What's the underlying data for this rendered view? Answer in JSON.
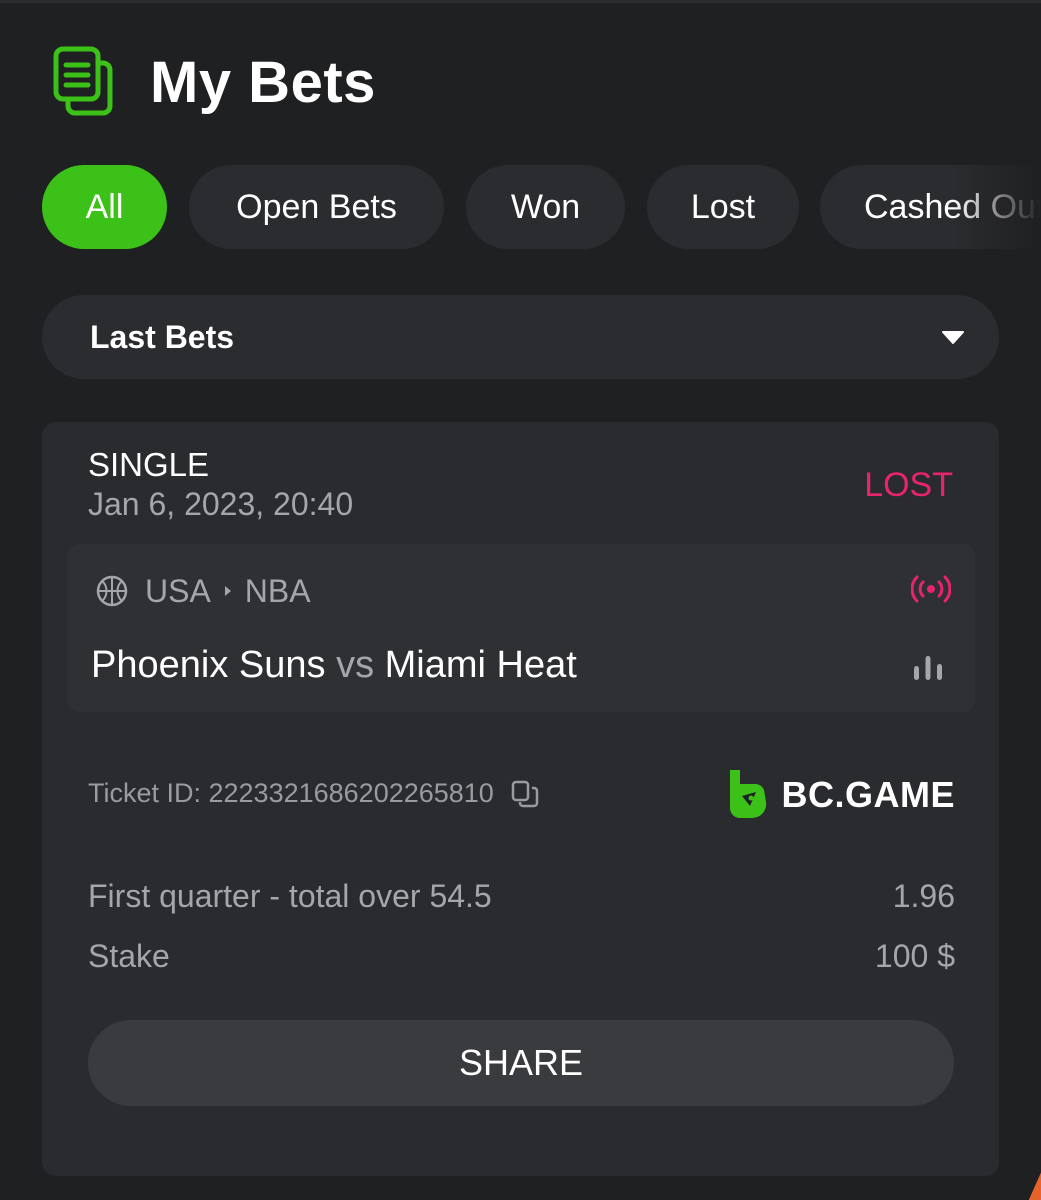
{
  "header": {
    "title": "My Bets",
    "icon": "bets-document-icon"
  },
  "tabs": [
    {
      "label": "All",
      "active": true
    },
    {
      "label": "Open Bets",
      "active": false
    },
    {
      "label": "Won",
      "active": false
    },
    {
      "label": "Lost",
      "active": false
    },
    {
      "label": "Cashed Out",
      "active": false
    }
  ],
  "filter": {
    "selected": "Last Bets",
    "icon": "caret-down-icon"
  },
  "bet": {
    "type": "SINGLE",
    "date": "Jan 6, 2023, 20:40",
    "status": "LOST",
    "country": "USA",
    "league": "NBA",
    "home_team": "Phoenix Suns",
    "vs": "vs",
    "away_team": "Miami Heat",
    "ticket_id": "Ticket ID: 2223321686202265810",
    "brand": "BC.GAME",
    "market": "First quarter - total over 54.5",
    "odds": "1.96",
    "stake_label": "Stake",
    "stake_value": "100 $",
    "share_label": "SHARE"
  },
  "colors": {
    "accent_green": "#3bc117",
    "status_lost": "#e8236f",
    "background": "#1f2022",
    "card": "#2a2b2e"
  }
}
